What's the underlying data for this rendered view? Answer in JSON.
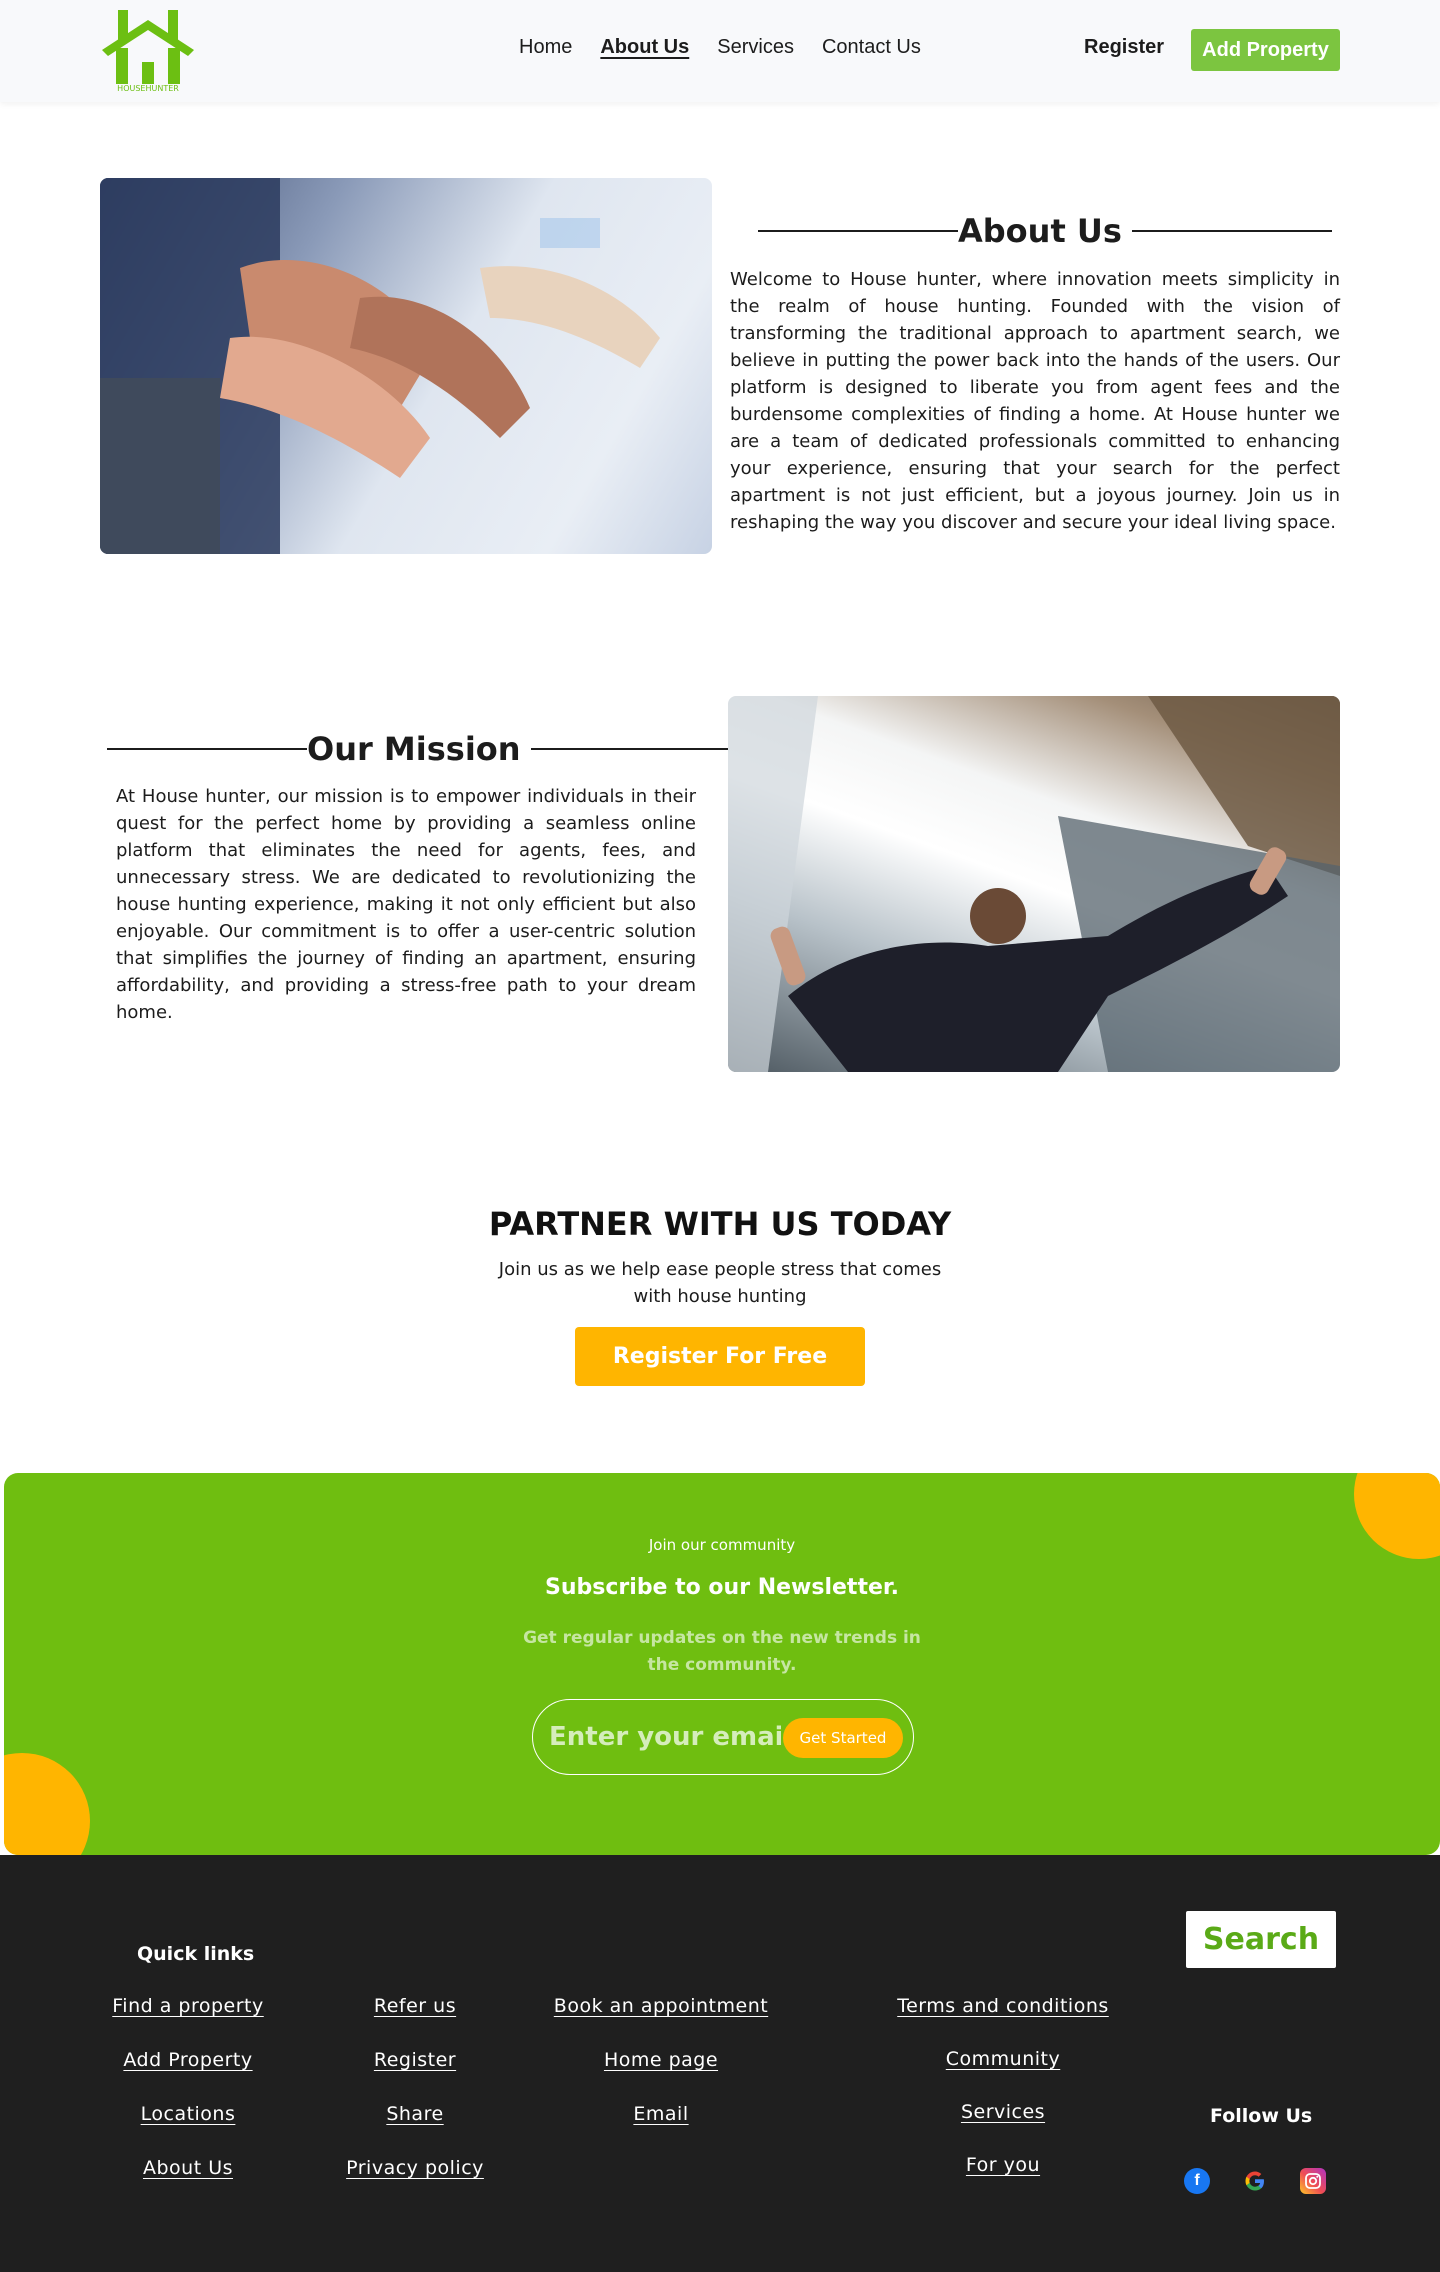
{
  "nav": {
    "logo_text": "HOUSEHUNTER",
    "links": [
      {
        "label": "Home"
      },
      {
        "label": "About Us"
      },
      {
        "label": "Services"
      },
      {
        "label": "Contact Us"
      }
    ],
    "register": "Register",
    "add_property": "Add Property"
  },
  "about": {
    "title": "About Us",
    "text": "Welcome to House hunter, where innovation meets simplicity in the realm of house hunting. Founded with the vision of transforming the traditional approach to apartment search, we believe in putting the power back into the hands of the users. Our platform is designed to liberate you from agent fees and the burdensome complexities of finding a home. At House hunter we are a team of dedicated professionals committed to enhancing your experience, ensuring that your search for the perfect apartment is not just efficient, but a joyous journey. Join us in reshaping the way you discover and secure your ideal living space."
  },
  "mission": {
    "title": "Our Mission",
    "text": "At House hunter, our mission is to empower individuals in their quest for the perfect home by providing a seamless online platform that eliminates the need for agents, fees, and unnecessary stress. We are dedicated to revolutionizing the house hunting experience, making it not only efficient but also enjoyable. Our commitment is to offer a user-centric solution that simplifies the journey of finding an apartment, ensuring affordability, and providing a stress-free path to your dream home."
  },
  "partner": {
    "title": "PARTNER WITH US TODAY",
    "subtitle": "Join us as we help ease people stress that comes with house hunting",
    "button": "Register For Free"
  },
  "newsletter": {
    "kicker": "Join our community",
    "title": "Subscribe to our Newsletter.",
    "description": "Get regular updates on the new trends in the community.",
    "email_placeholder": "Enter your email",
    "button": "Get Started"
  },
  "footer": {
    "quick_links": "Quick links",
    "search_button": "Search",
    "follow_us": "Follow Us",
    "col1": [
      "Find a property",
      "Add Property",
      "Locations",
      "About Us"
    ],
    "col2": [
      "Refer us",
      "Register",
      "Share",
      "Privacy policy"
    ],
    "col3": [
      "Book an appointment",
      "Home page",
      "Email"
    ],
    "col4": [
      "Terms and conditions",
      "Community",
      "Services",
      "For you"
    ],
    "social_icons": [
      "facebook-icon",
      "google-icon",
      "instagram-icon"
    ]
  },
  "colors": {
    "brand_green": "#6fbe10",
    "accent_orange": "#ffb500",
    "footer_bg": "#1f1f1f"
  }
}
